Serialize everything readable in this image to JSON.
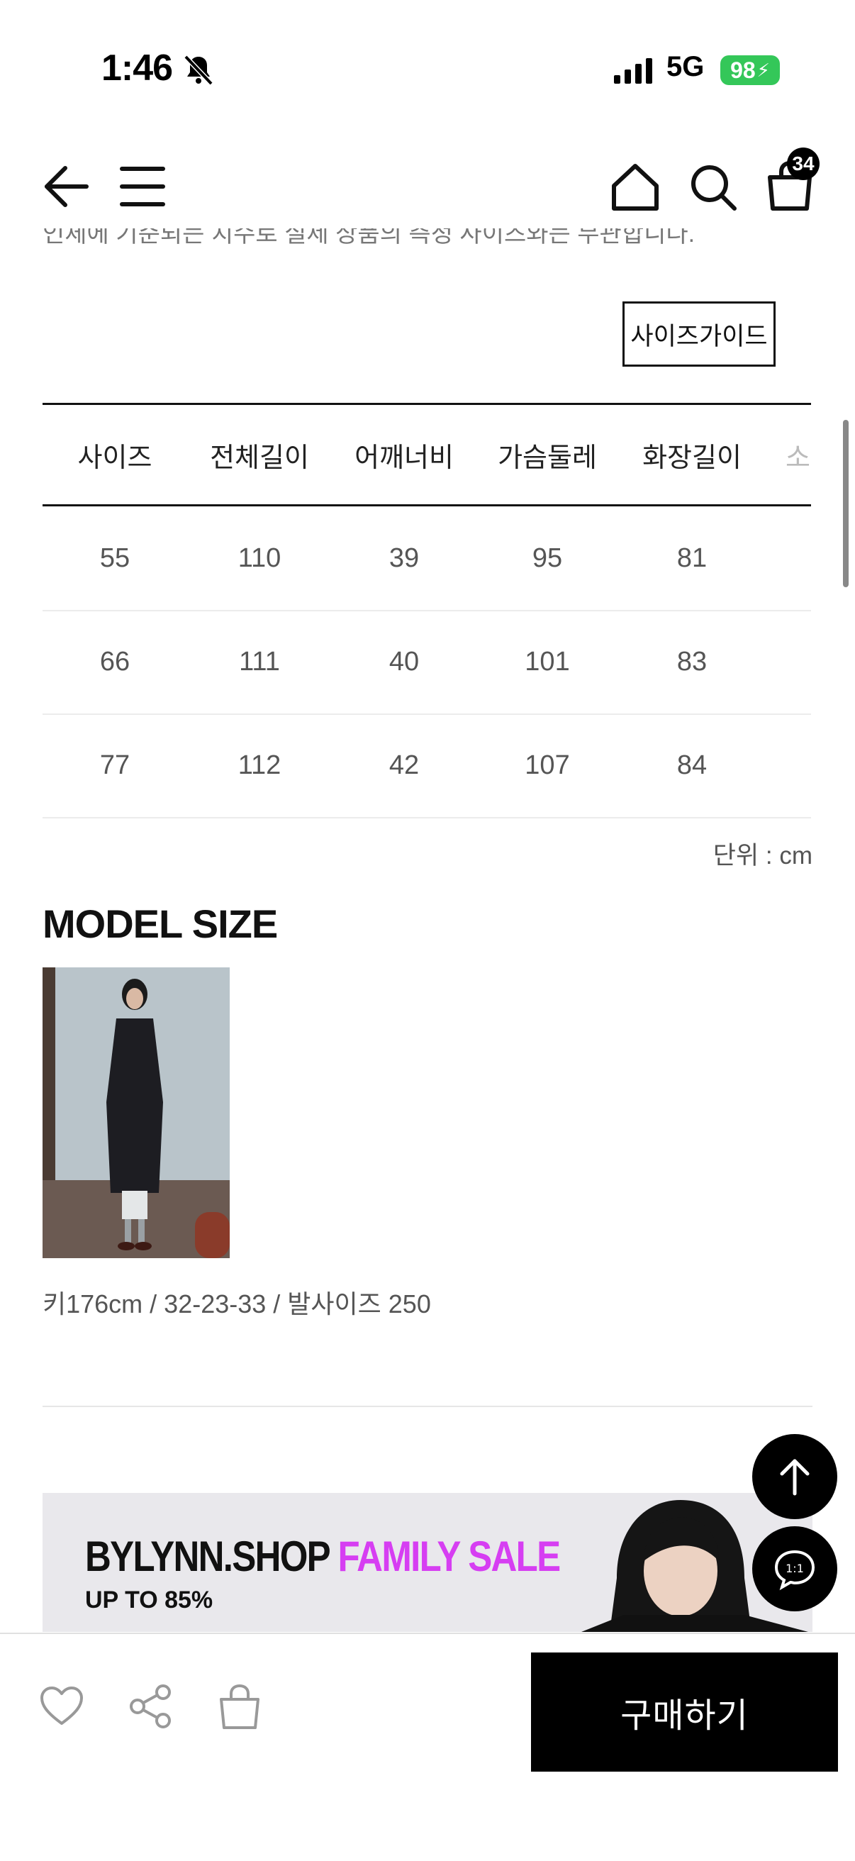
{
  "status_bar": {
    "time": "1:46",
    "network": "5G",
    "battery": "98"
  },
  "header": {
    "cart_count": "34"
  },
  "intro_text": "인체에 기준되는 치수로 실제 상품의 측정 사이즈와는 무관합니다.",
  "size_guide_label": "사이즈가이드",
  "size_table": {
    "headers": [
      "사이즈",
      "전체길이",
      "어깨너비",
      "가슴둘레",
      "화장길이",
      "소"
    ],
    "rows": [
      [
        "55",
        "110",
        "39",
        "95",
        "81"
      ],
      [
        "66",
        "111",
        "40",
        "101",
        "83"
      ],
      [
        "77",
        "112",
        "42",
        "107",
        "84"
      ]
    ],
    "unit": "단위 : cm"
  },
  "model": {
    "title": "MODEL SIZE",
    "info": "키176cm / 32-23-33 / 발사이즈 250"
  },
  "banner": {
    "title_main": "BYLYNN.SHOP",
    "title_accent": "FAMILY SALE",
    "subtitle": "UP TO 85%",
    "accent_color": "#d63ef2"
  },
  "floating": {
    "chat_label": "1:1"
  },
  "bottom_bar": {
    "buy_label": "구매하기"
  }
}
